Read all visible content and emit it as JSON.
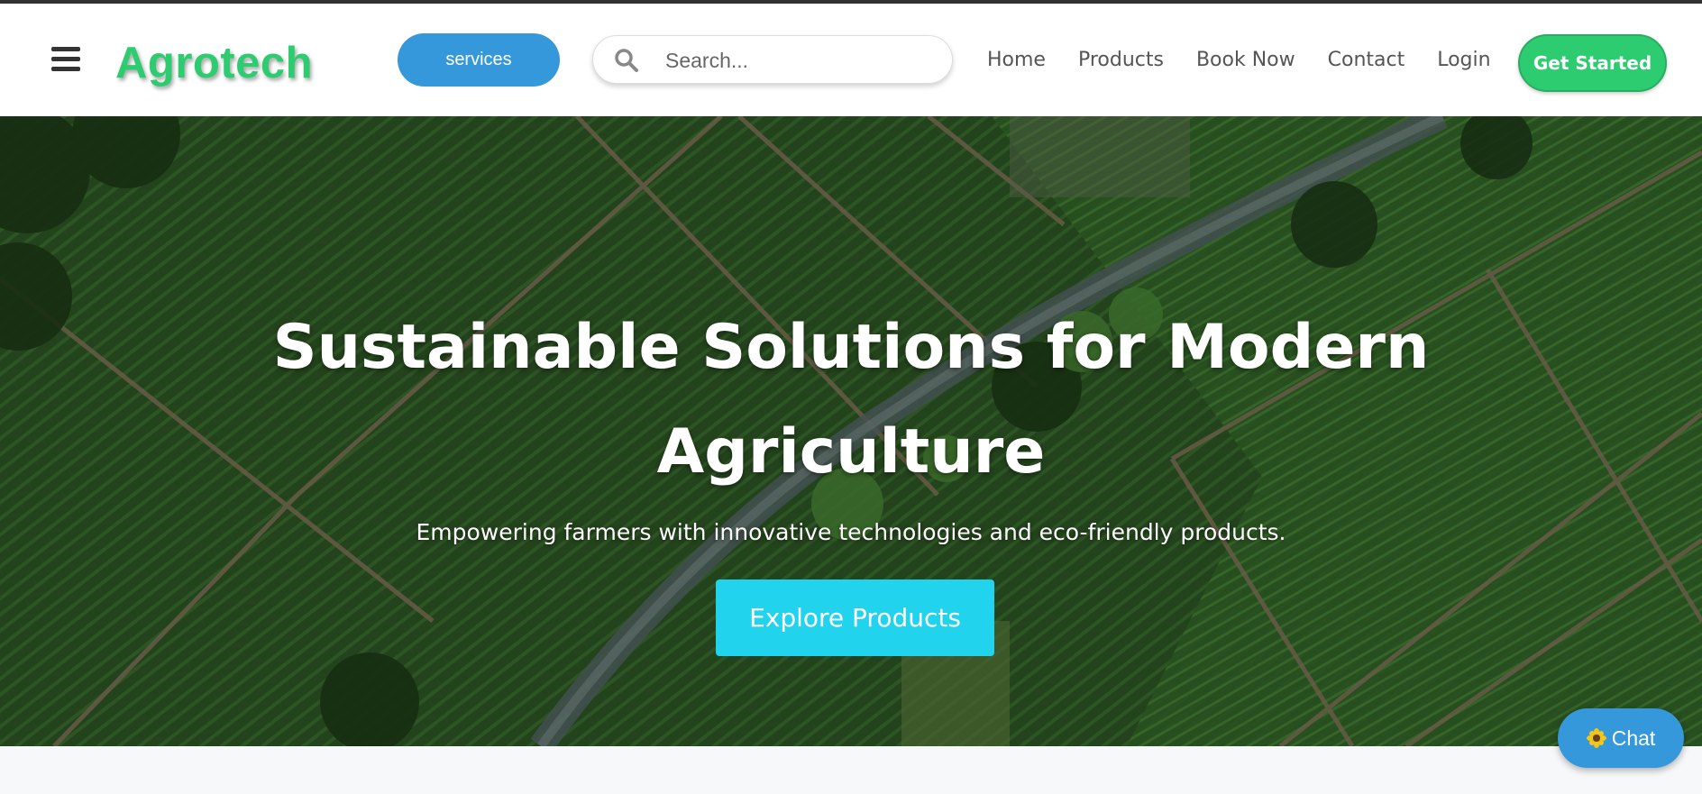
{
  "header": {
    "logo": "Agrotech",
    "services_label": "services",
    "search_placeholder": "Search...",
    "nav": [
      "Home",
      "Products",
      "Book Now",
      "Contact",
      "Login"
    ],
    "cta_label": "Get Started"
  },
  "hero": {
    "title": "Sustainable Solutions for Modern Agriculture",
    "subtitle": "Empowering farmers with innovative technologies and eco-friendly products.",
    "button_label": "Explore Products"
  },
  "chat": {
    "label": "Chat"
  },
  "colors": {
    "brand_green": "#2ecc71",
    "services_blue": "#3498db",
    "explore_cyan": "#22d3ee",
    "chat_blue": "#3498db"
  },
  "icons": [
    "hamburger-menu-icon",
    "search-icon",
    "sunflower-icon"
  ]
}
